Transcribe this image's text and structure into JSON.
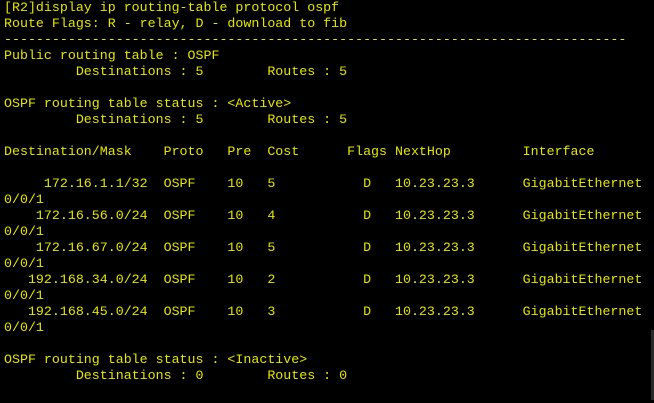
{
  "terminal": {
    "device": "R2",
    "foreground_color": "#e6e600",
    "background_color": "#000000",
    "lines": [
      "[R2]display ip routing-table protocol ospf",
      "Route Flags: R - relay, D - download to fib",
      "------------------------------------------------------------------------------",
      "Public routing table : OSPF",
      "         Destinations : 5        Routes : 5",
      "",
      "OSPF routing table status : <Active>",
      "         Destinations : 5        Routes : 5",
      "",
      "Destination/Mask    Proto   Pre  Cost      Flags NextHop         Interface",
      "",
      "     172.16.1.1/32  OSPF    10   5           D   10.23.23.3      GigabitEthernet",
      "0/0/1",
      "    172.16.56.0/24  OSPF    10   4           D   10.23.23.3      GigabitEthernet",
      "0/0/1",
      "    172.16.67.0/24  OSPF    10   5           D   10.23.23.3      GigabitEthernet",
      "0/0/1",
      "   192.168.34.0/24  OSPF    10   2           D   10.23.23.3      GigabitEthernet",
      "0/0/1",
      "   192.168.45.0/24  OSPF    10   3           D   10.23.23.3      GigabitEthernet",
      "0/0/1",
      "",
      "OSPF routing table status : <Inactive>",
      "         Destinations : 0        Routes : 0"
    ]
  }
}
